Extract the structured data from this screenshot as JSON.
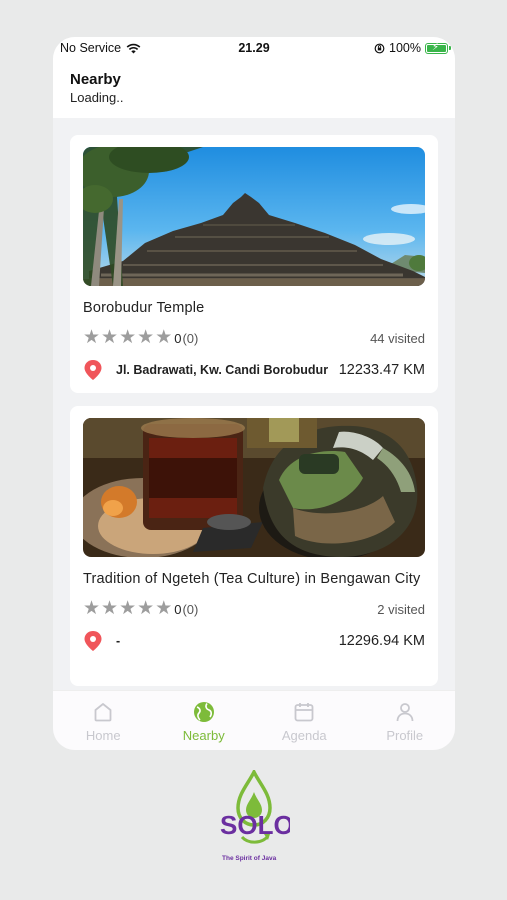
{
  "status_bar": {
    "carrier": "No Service",
    "time": "21.29",
    "battery": "100%"
  },
  "header": {
    "title": "Nearby",
    "subtitle": "Loading.."
  },
  "places": [
    {
      "title": "Borobudur Temple",
      "rating_value": "0",
      "rating_count": "(0)",
      "visited": "44 visited",
      "address": "Jl. Badrawati, Kw. Candi Borobudur",
      "distance": "12233.47 KM",
      "image_icon": "temple-photo"
    },
    {
      "title": "Tradition of Ngeteh (Tea Culture) in Bengawan City",
      "rating_value": "0",
      "rating_count": "(0)",
      "visited": "2 visited",
      "address": "-",
      "distance": "12296.94 KM",
      "image_icon": "tea-photo"
    }
  ],
  "nav": {
    "items": [
      {
        "label": "Home",
        "icon": "home-icon",
        "active": false
      },
      {
        "label": "Nearby",
        "icon": "globe-icon",
        "active": true
      },
      {
        "label": "Agenda",
        "icon": "calendar-icon",
        "active": false
      },
      {
        "label": "Profile",
        "icon": "user-icon",
        "active": false
      }
    ]
  },
  "brand": {
    "tagline": "The Spirit of Java",
    "accent_green": "#7dbb3a",
    "accent_purple": "#6b2fa0"
  },
  "colors": {
    "pin_red": "#f0555a",
    "star_grey": "#9d9d9d"
  }
}
